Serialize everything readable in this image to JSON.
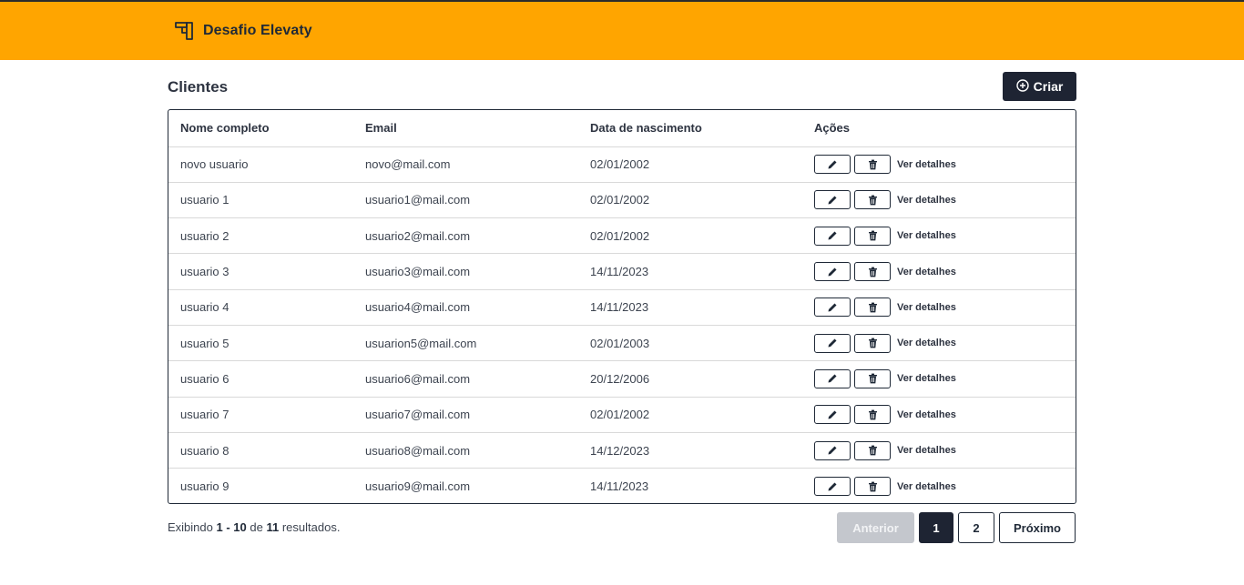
{
  "header": {
    "brand_name": "Desafio Elevaty",
    "background_color": "#ffa500",
    "logo_icon": "brand-logo-icon"
  },
  "page": {
    "title": "Clientes",
    "create_label": "Criar",
    "create_icon": "plus-circle-icon"
  },
  "table": {
    "columns": [
      "Nome completo",
      "Email",
      "Data de nascimento",
      "Ações"
    ],
    "details_label": "Ver detalhes",
    "rows": [
      {
        "name": "novo usuario",
        "email": "novo@mail.com",
        "birth": "02/01/2002"
      },
      {
        "name": "usuario 1",
        "email": "usuario1@mail.com",
        "birth": "02/01/2002"
      },
      {
        "name": "usuario 2",
        "email": "usuario2@mail.com",
        "birth": "02/01/2002"
      },
      {
        "name": "usuario 3",
        "email": "usuario3@mail.com",
        "birth": "14/11/2023"
      },
      {
        "name": "usuario 4",
        "email": "usuario4@mail.com",
        "birth": "14/11/2023"
      },
      {
        "name": "usuario 5",
        "email": "usuarion5@mail.com",
        "birth": "02/01/2003"
      },
      {
        "name": "usuario 6",
        "email": "usuario6@mail.com",
        "birth": "20/12/2006"
      },
      {
        "name": "usuario 7",
        "email": "usuario7@mail.com",
        "birth": "02/01/2002"
      },
      {
        "name": "usuario 8",
        "email": "usuario8@mail.com",
        "birth": "14/12/2023"
      },
      {
        "name": "usuario 9",
        "email": "usuario9@mail.com",
        "birth": "14/11/2023"
      }
    ]
  },
  "footer": {
    "prefix": "Exibindo",
    "range": "1 - 10",
    "of": "de",
    "total": "11",
    "suffix": "resultados."
  },
  "pagination": {
    "prev": "Anterior",
    "pages": [
      "1",
      "2"
    ],
    "current": "1",
    "next": "Próximo"
  }
}
